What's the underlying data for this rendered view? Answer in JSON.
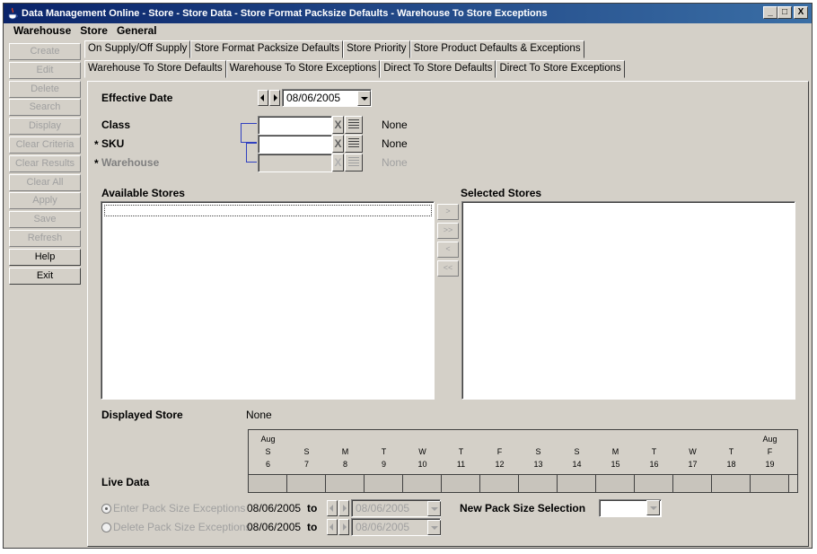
{
  "window": {
    "title": "Data Management Online - Store - Store Data - Store Format Packsize Defaults - Warehouse To Store Exceptions",
    "controls": {
      "minimize": "_",
      "maximize": "□",
      "close": "X"
    }
  },
  "menu": [
    "Warehouse",
    "Store",
    "General"
  ],
  "actions": {
    "create": "Create",
    "edit": "Edit",
    "delete": "Delete",
    "search": "Search",
    "display": "Display",
    "clear_criteria": "Clear Criteria",
    "clear_results": "Clear Results",
    "clear_all": "Clear All",
    "apply": "Apply",
    "save": "Save",
    "refresh": "Refresh",
    "help": "Help",
    "exit": "Exit"
  },
  "tabs_top": [
    "On Supply/Off Supply",
    "Store Format Packsize Defaults",
    "Store Priority",
    "Store Product Defaults & Exceptions"
  ],
  "tabs_second": [
    "Warehouse To Store Defaults",
    "Warehouse To Store Exceptions",
    "Direct To Store Defaults",
    "Direct To Store Exceptions"
  ],
  "form": {
    "effective_date_label": "Effective Date",
    "effective_date": "08/06/2005",
    "class_label": "Class",
    "class_value": "None",
    "sku_label": "SKU",
    "sku_required": "*",
    "sku_value": "None",
    "warehouse_label": "Warehouse",
    "warehouse_required": "*",
    "warehouse_value": "None",
    "clear_glyph": "X"
  },
  "stores": {
    "available_label": "Available Stores",
    "selected_label": "Selected Stores",
    "move_buttons": [
      ">",
      ">>",
      "<",
      "<<"
    ]
  },
  "displayed_store_label": "Displayed Store",
  "displayed_store_value": "None",
  "live_data_label": "Live Data",
  "calendar": [
    {
      "month": "Aug",
      "dow": "S",
      "day": "6"
    },
    {
      "month": "",
      "dow": "S",
      "day": "7"
    },
    {
      "month": "",
      "dow": "M",
      "day": "8"
    },
    {
      "month": "",
      "dow": "T",
      "day": "9"
    },
    {
      "month": "",
      "dow": "W",
      "day": "10"
    },
    {
      "month": "",
      "dow": "T",
      "day": "11"
    },
    {
      "month": "",
      "dow": "F",
      "day": "12"
    },
    {
      "month": "",
      "dow": "S",
      "day": "13"
    },
    {
      "month": "",
      "dow": "S",
      "day": "14"
    },
    {
      "month": "",
      "dow": "M",
      "day": "15"
    },
    {
      "month": "",
      "dow": "T",
      "day": "16"
    },
    {
      "month": "",
      "dow": "W",
      "day": "17"
    },
    {
      "month": "",
      "dow": "T",
      "day": "18"
    },
    {
      "month": "Aug",
      "dow": "F",
      "day": "19"
    }
  ],
  "exceptions": {
    "enter_label": "Enter Pack Size Exceptions",
    "enter_from": "08/06/2005",
    "enter_to": "08/06/2005",
    "delete_label": "Delete Pack Size Exceptions",
    "delete_from": "08/06/2005",
    "delete_to": "08/06/2005",
    "to_label": "to",
    "new_pack_label": "New Pack Size Selection",
    "new_pack_value": ""
  }
}
